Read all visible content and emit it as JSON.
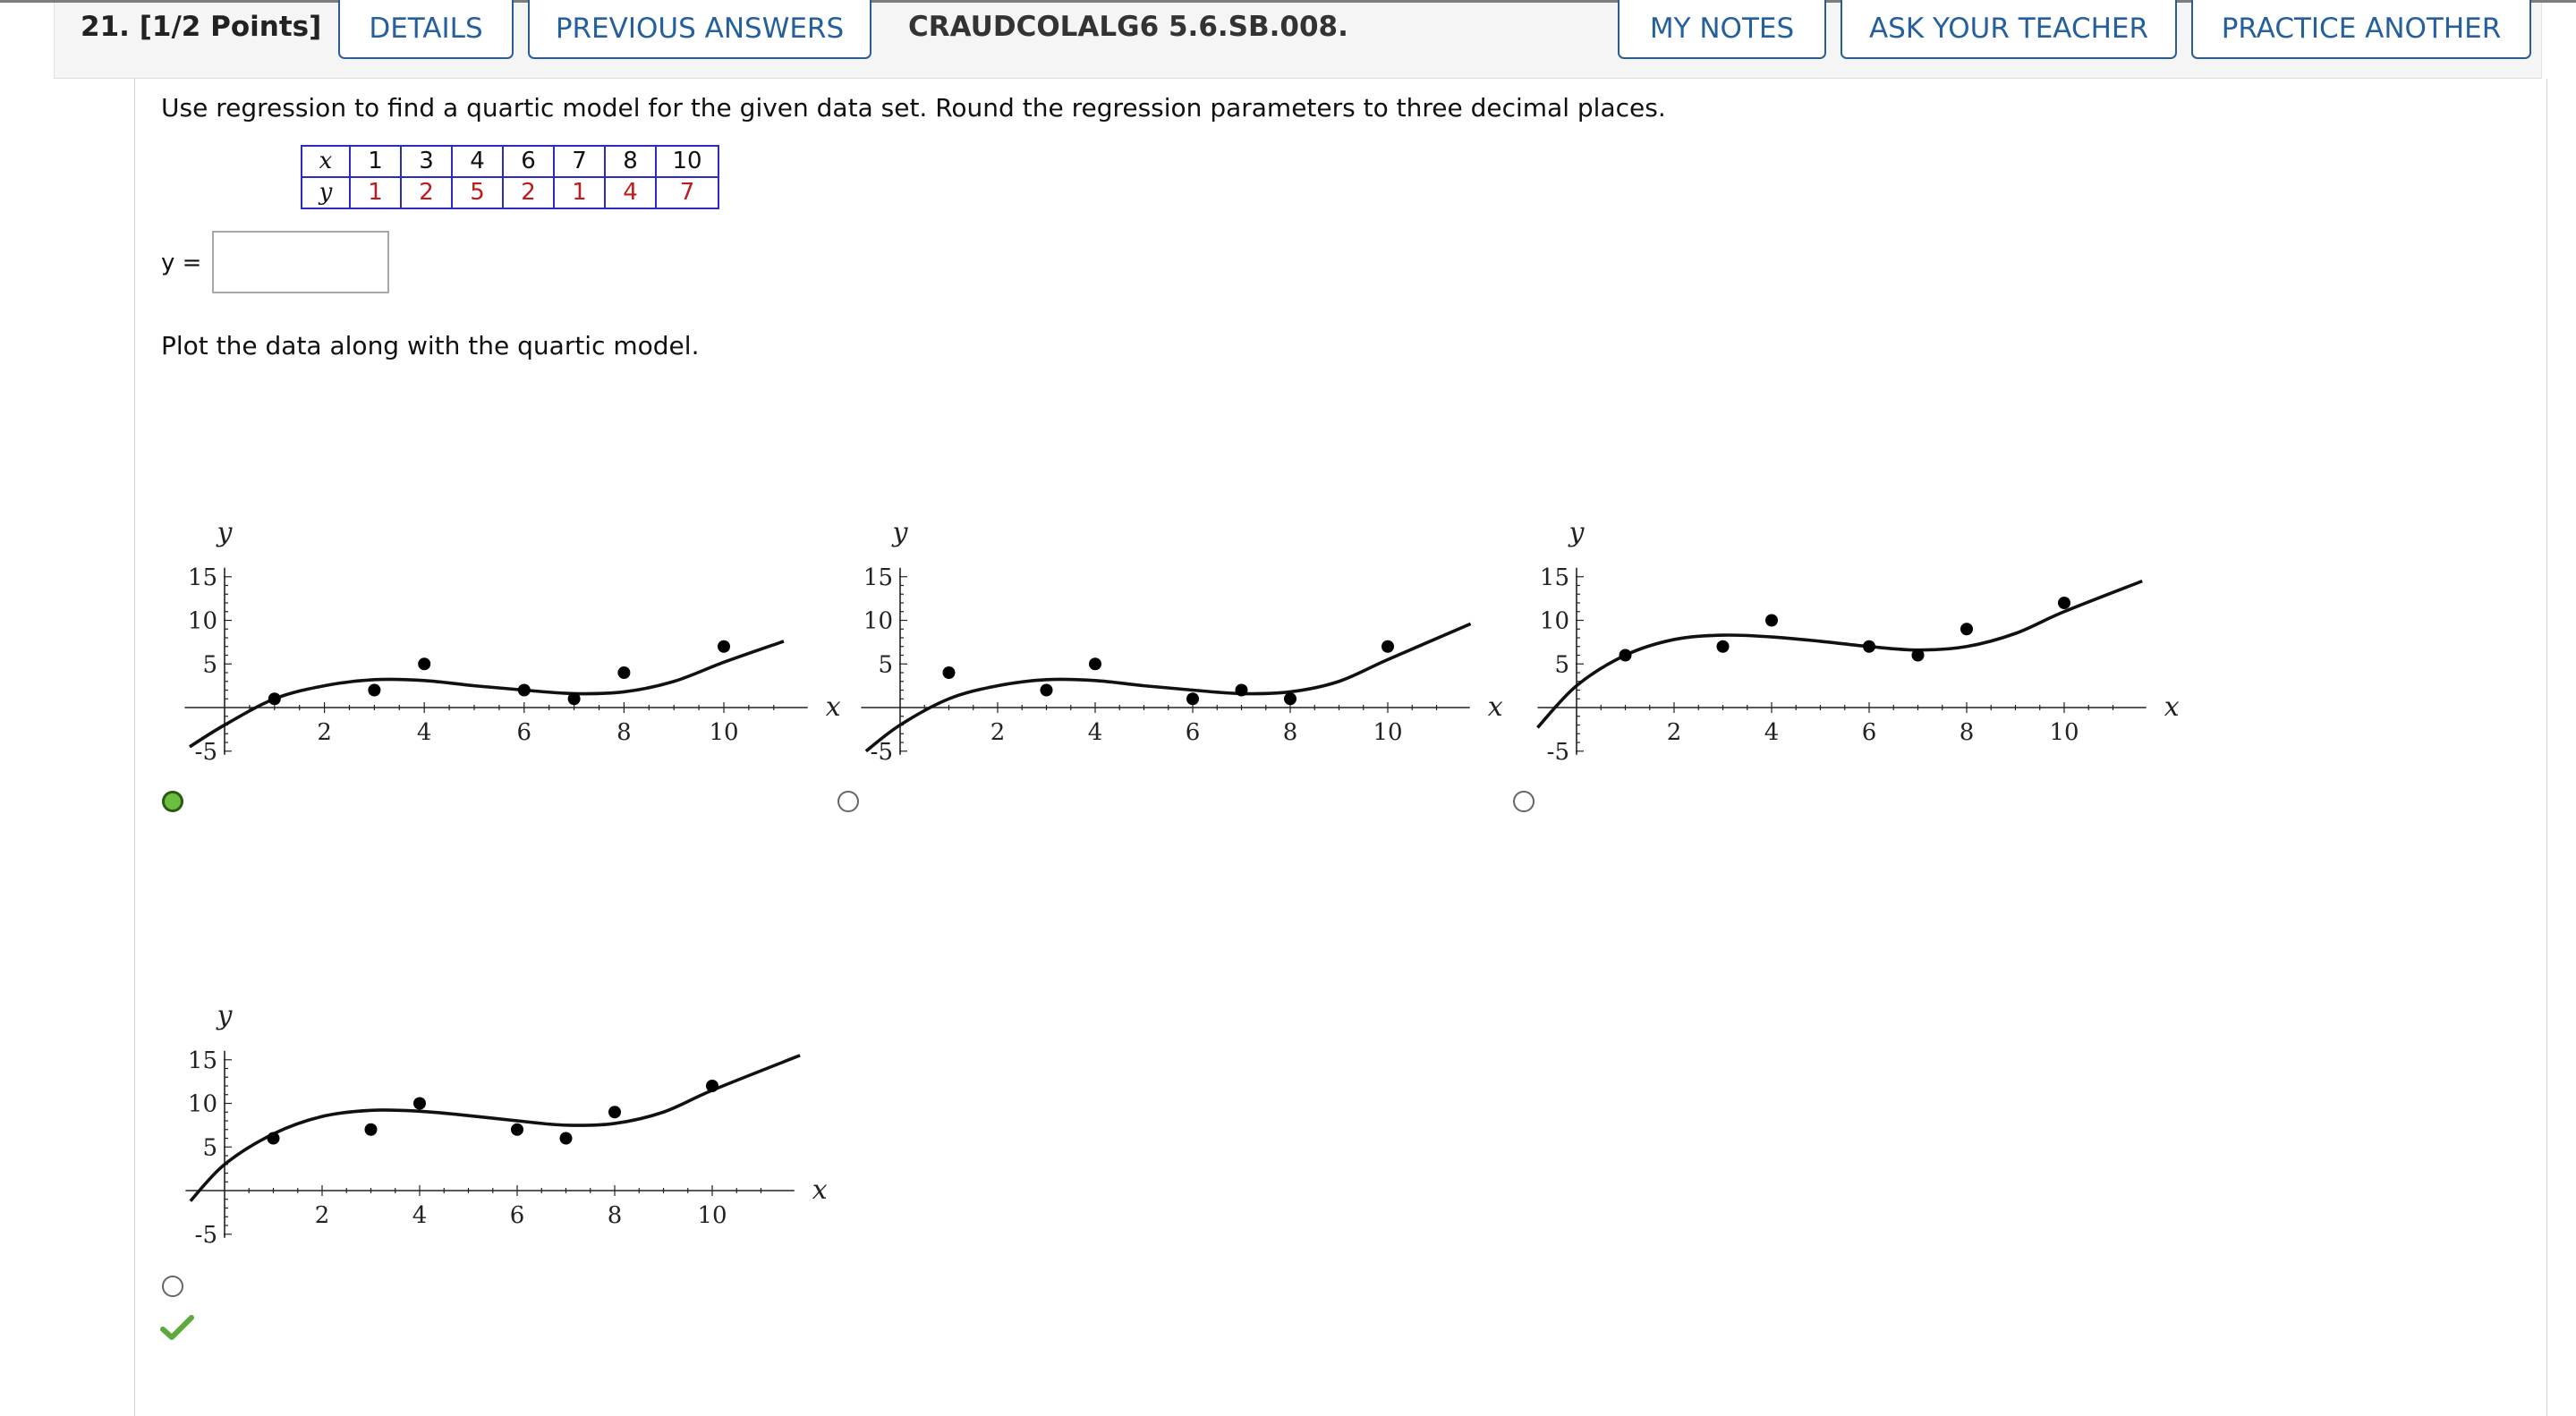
{
  "header": {
    "question_number": "21. [1/2 Points]",
    "details_label": "DETAILS",
    "previous_answers_label": "PREVIOUS ANSWERS",
    "question_id": "CRAUDCOLALG6 5.6.SB.008.",
    "my_notes_label": "MY NOTES",
    "ask_teacher_label": "ASK YOUR TEACHER",
    "practice_another_label": "PRACTICE ANOTHER"
  },
  "question": {
    "prompt": "Use regression to find a quartic model for the given data set. Round the regression parameters to three decimal places.",
    "table": {
      "x_header": "x",
      "y_header": "y",
      "x_values": [
        "1",
        "3",
        "4",
        "6",
        "7",
        "8",
        "10"
      ],
      "y_values": [
        "1",
        "2",
        "5",
        "2",
        "1",
        "4",
        "7"
      ]
    },
    "answer_label": "y =",
    "answer_value": "",
    "plot_prompt": "Plot the data along with the quartic model."
  },
  "options": [
    {
      "selected": true
    },
    {
      "selected": false
    },
    {
      "selected": false
    },
    {
      "selected": false,
      "marked_correct": true
    }
  ],
  "chart_data": [
    {
      "type": "scatter",
      "xlabel": "x",
      "ylabel": "y",
      "xlim": [
        -0.8,
        11.5
      ],
      "ylim": [
        -5,
        15
      ],
      "x_ticks": [
        "2",
        "4",
        "6",
        "8",
        "10"
      ],
      "y_ticks": [
        "-5",
        "5",
        "10",
        "15"
      ],
      "points": [
        [
          1,
          1
        ],
        [
          3,
          2
        ],
        [
          4,
          5
        ],
        [
          6,
          2
        ],
        [
          7,
          1
        ],
        [
          8,
          4
        ],
        [
          10,
          7
        ]
      ],
      "curve": [
        [
          -0.7,
          -4.5
        ],
        [
          0,
          -2
        ],
        [
          1,
          1
        ],
        [
          2,
          2.5
        ],
        [
          3,
          3.2
        ],
        [
          4,
          3.1
        ],
        [
          5,
          2.5
        ],
        [
          6,
          2
        ],
        [
          7,
          1.6
        ],
        [
          8,
          1.8
        ],
        [
          9,
          3
        ],
        [
          10,
          5.2
        ],
        [
          11.2,
          7.6
        ]
      ]
    },
    {
      "type": "scatter",
      "xlabel": "x",
      "ylabel": "y",
      "xlim": [
        -0.8,
        11.5
      ],
      "ylim": [
        -5,
        15
      ],
      "x_ticks": [
        "2",
        "4",
        "6",
        "8",
        "10"
      ],
      "y_ticks": [
        "-5",
        "5",
        "10",
        "15"
      ],
      "points": [
        [
          1,
          4
        ],
        [
          3,
          2
        ],
        [
          4,
          5
        ],
        [
          6,
          1
        ],
        [
          7,
          2
        ],
        [
          8,
          1
        ],
        [
          10,
          7
        ]
      ],
      "curve": [
        [
          -0.7,
          -5
        ],
        [
          0,
          -2
        ],
        [
          1,
          1
        ],
        [
          2,
          2.5
        ],
        [
          3,
          3.2
        ],
        [
          4,
          3.1
        ],
        [
          5,
          2.5
        ],
        [
          6,
          2
        ],
        [
          7,
          1.6
        ],
        [
          8,
          1.8
        ],
        [
          9,
          3
        ],
        [
          10,
          5.5
        ],
        [
          11.7,
          9.6
        ]
      ]
    },
    {
      "type": "scatter",
      "xlabel": "x",
      "ylabel": "y",
      "xlim": [
        -0.8,
        11.5
      ],
      "ylim": [
        -5,
        15
      ],
      "x_ticks": [
        "2",
        "4",
        "6",
        "8",
        "10"
      ],
      "y_ticks": [
        "-5",
        "5",
        "10",
        "15"
      ],
      "points": [
        [
          1,
          6
        ],
        [
          3,
          7
        ],
        [
          4,
          10
        ],
        [
          6,
          7
        ],
        [
          7,
          6
        ],
        [
          8,
          9
        ],
        [
          10,
          12
        ]
      ],
      "curve": [
        [
          -0.8,
          -2.3
        ],
        [
          0,
          2.5
        ],
        [
          1,
          6
        ],
        [
          2,
          7.8
        ],
        [
          3,
          8.3
        ],
        [
          4,
          8.1
        ],
        [
          5,
          7.6
        ],
        [
          6,
          7
        ],
        [
          7,
          6.6
        ],
        [
          8,
          7
        ],
        [
          9,
          8.5
        ],
        [
          10,
          11
        ],
        [
          11.6,
          14.5
        ]
      ]
    },
    {
      "type": "scatter",
      "xlabel": "x",
      "ylabel": "y",
      "xlim": [
        -0.8,
        11.5
      ],
      "ylim": [
        -5,
        15
      ],
      "x_ticks": [
        "2",
        "4",
        "6",
        "8",
        "10"
      ],
      "y_ticks": [
        "-5",
        "5",
        "10",
        "15"
      ],
      "points": [
        [
          1,
          6
        ],
        [
          3,
          7
        ],
        [
          4,
          10
        ],
        [
          6,
          7
        ],
        [
          7,
          6
        ],
        [
          8,
          9
        ],
        [
          10,
          12
        ]
      ],
      "curve": [
        [
          -0.7,
          -1.2
        ],
        [
          0,
          3
        ],
        [
          1,
          6.5
        ],
        [
          2,
          8.5
        ],
        [
          3,
          9.2
        ],
        [
          4,
          9.1
        ],
        [
          5,
          8.6
        ],
        [
          6,
          8
        ],
        [
          7,
          7.5
        ],
        [
          8,
          7.7
        ],
        [
          9,
          9
        ],
        [
          10,
          11.5
        ],
        [
          11.8,
          15.5
        ]
      ]
    }
  ]
}
